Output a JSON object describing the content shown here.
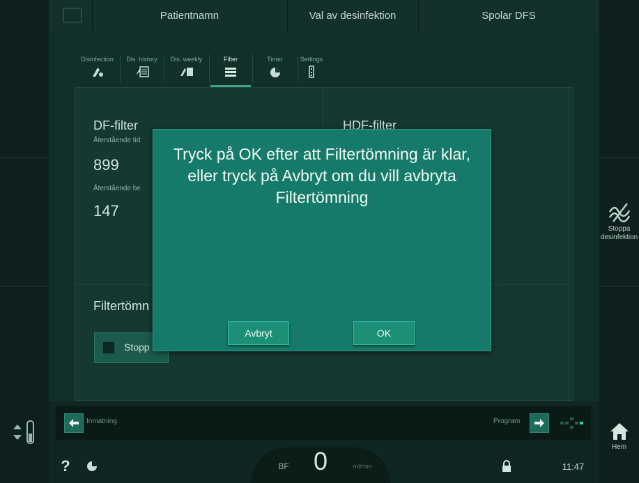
{
  "topbar": {
    "patient": "Patientnamn",
    "disinfection_choice": "Val av desinfektion",
    "status": "Spolar DFS"
  },
  "tabs": [
    {
      "label": "Disinfection",
      "icon": "disinfection-icon"
    },
    {
      "label": "Dis. history",
      "icon": "history-list-icon"
    },
    {
      "label": "Dis. weekly",
      "icon": "weekly-icon"
    },
    {
      "label": "Filter",
      "icon": "filter-icon"
    },
    {
      "label": "Timer",
      "icon": "timer-icon"
    },
    {
      "label": "Settings",
      "icon": "settings-icon"
    }
  ],
  "df": {
    "title": "DF-filter",
    "remaining_time_label": "Återstående tid",
    "remaining_time_value": "899",
    "remaining_treat_label": "Återstående be",
    "remaining_treat_value": "147"
  },
  "hdf": {
    "title": "HDF-filter"
  },
  "filter_empty": {
    "title": "Filtertömn",
    "stop_label": "Stopp"
  },
  "dialog": {
    "message": "Tryck på OK efter att Filtertömning är klar, eller tryck på Avbryt om du vill avbryta Filtertömning",
    "cancel_label": "Avbryt",
    "ok_label": "OK"
  },
  "navbar": {
    "back_label": "Inmatning",
    "forward_label": "Program"
  },
  "right_rail": {
    "stop_disinfection": "Stoppa desinfektion",
    "home": "Hem"
  },
  "status_bar": {
    "help": "?",
    "bf_label": "BF",
    "bf_value": "0",
    "bf_unit": "ml/min",
    "time": "11:47"
  },
  "colors": {
    "dialog_bg": "#157a69",
    "button_bg": "#1c9077",
    "accent": "#3fa38d",
    "background": "#0f2622"
  }
}
